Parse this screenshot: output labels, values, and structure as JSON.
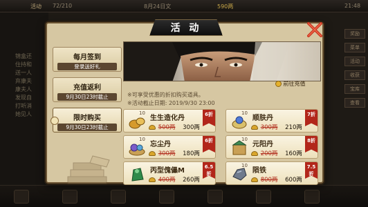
{
  "topbar": {
    "tab_label": "活动",
    "stamina": "72/210",
    "date": "8月24日文",
    "coins": "590两",
    "time": "21:48"
  },
  "bg_left": {
    "lines": [
      "锦盒还",
      "住持和",
      "送一人",
      "弃康夫",
      "康夫人",
      "发现自",
      "打听消",
      "她见人"
    ]
  },
  "bg_right": {
    "buttons": [
      "奖励",
      "菜单",
      "活动",
      "收获",
      "宝库",
      "查看"
    ]
  },
  "dialog": {
    "title": "活 动",
    "tabs": [
      {
        "title": "每月签到",
        "subtitle": "登录送好礼"
      },
      {
        "title": "充值返利",
        "subtitle": "9月30日23时截止"
      },
      {
        "title": "限时购买",
        "subtitle": "9月30日23时截止"
      }
    ],
    "recharge_label": "前往充值",
    "info_line1": "※可享受优惠的折扣购买道具。",
    "info_line2": "※活动截止日期: 2019/9/30 23:00",
    "items": [
      {
        "count": "10",
        "name": "生生造化丹",
        "orig": "500两",
        "price": "300两",
        "discount": "6折"
      },
      {
        "count": "10",
        "name": "顺肤丹",
        "orig": "300两",
        "price": "210两",
        "discount": "7折"
      },
      {
        "count": "10",
        "name": "忘尘丹",
        "orig": "300两",
        "price": "180两",
        "discount": "6折"
      },
      {
        "count": "10",
        "name": "元阳丹",
        "orig": "200两",
        "price": "160两",
        "discount": "8折"
      },
      {
        "count": "",
        "name": "丙型傀儡M",
        "orig": "400两",
        "price": "260两",
        "discount": "6.5折"
      },
      {
        "count": "10",
        "name": "陨铁",
        "orig": "800两",
        "price": "600两",
        "discount": "7.5折"
      }
    ]
  },
  "colors": {
    "dialog_bg": "#d6c7a2",
    "badge": "#b2261a",
    "strike_price": "#b02a1a"
  }
}
